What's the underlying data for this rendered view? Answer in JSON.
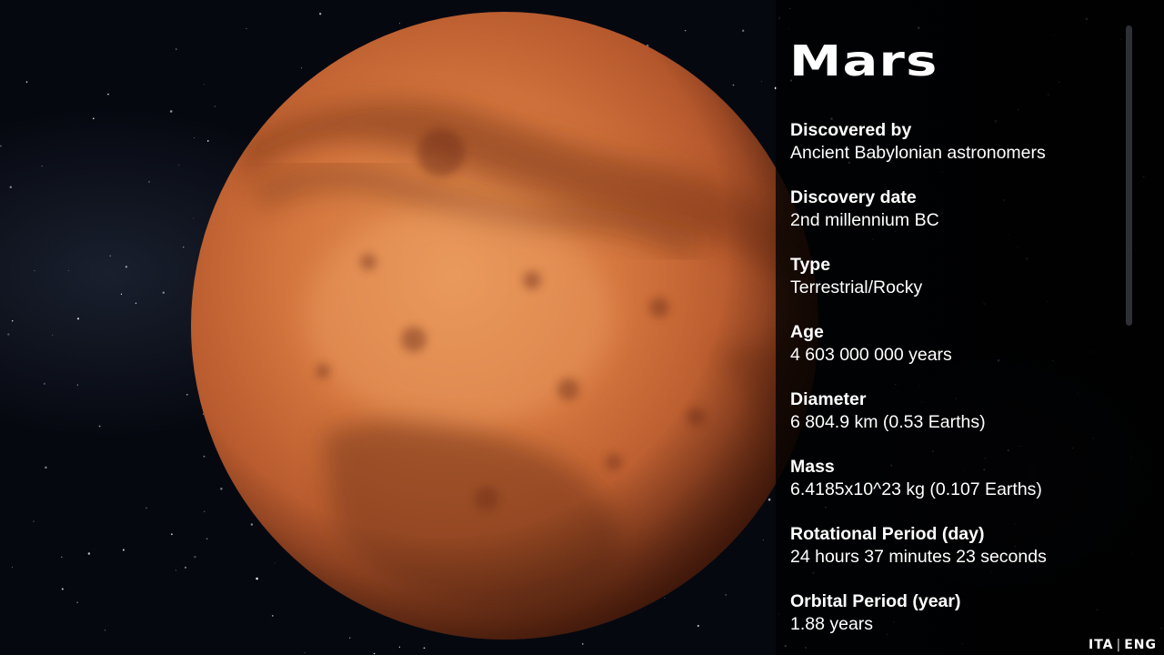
{
  "planet": {
    "name": "Mars",
    "colors": {
      "surface_light": "#e08a4e",
      "surface_mid": "#c2602f",
      "surface_dark": "#6e3118"
    }
  },
  "facts": [
    {
      "label": "Discovered by",
      "value": "Ancient Babylonian astronomers"
    },
    {
      "label": "Discovery date",
      "value": "2nd millennium BC"
    },
    {
      "label": "Type",
      "value": "Terrestrial/Rocky"
    },
    {
      "label": "Age",
      "value": "4 603 000 000 years"
    },
    {
      "label": "Diameter",
      "value": "6 804.9 km (0.53 Earths)"
    },
    {
      "label": "Mass",
      "value": "6.4185x10^23 kg (0.107 Earths)"
    },
    {
      "label": "Rotational Period (day)",
      "value": "24 hours 37 minutes 23 seconds"
    },
    {
      "label": "Orbital Period (year)",
      "value": "1.88 years"
    }
  ],
  "language": {
    "options": [
      "ITA",
      "ENG"
    ],
    "separator": "|"
  }
}
